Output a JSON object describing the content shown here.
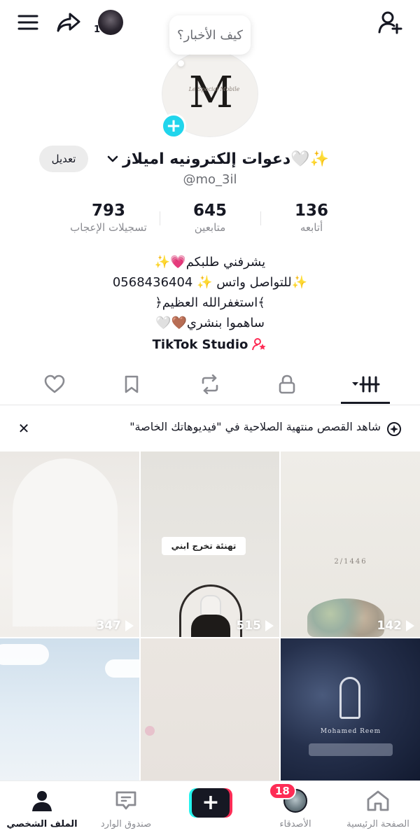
{
  "topbar": {
    "story_count": "1",
    "icons": [
      "menu-icon",
      "share-icon",
      "story-avatar",
      "add-friend-icon"
    ]
  },
  "bubble": {
    "text": "كيف الأخبار؟"
  },
  "profile": {
    "monogram": "M",
    "monogram_script": "Le Special Mobile",
    "display_name": "دعوات إلكترونيه اميلاز🤍✨",
    "username": "@mo_3il",
    "edit_label": "تعديل"
  },
  "stats": [
    {
      "value": "136",
      "label": "أتابعه"
    },
    {
      "value": "645",
      "label": "متابعين"
    },
    {
      "value": "793",
      "label": "تسجيلات الإعجاب"
    }
  ],
  "bio": {
    "lines": [
      "يشرفني طلبكم💗✨",
      "✨للتواصل واتس ✨ 0568436404",
      "﴾استغفرالله العظيم﴿",
      "ساهموا بنشري🤎🤍"
    ],
    "studio_link": "TikTok Studio"
  },
  "tabs": [
    "videos-grid-icon",
    "lock-icon",
    "repost-icon",
    "favorites-icon",
    "liked-icon"
  ],
  "banner": {
    "text": "شاهد القصص منتهية الصلاحية في \"فيديوهاتك الخاصة\""
  },
  "grid": {
    "tiles": [
      {
        "views": "347"
      },
      {
        "views": "515",
        "caption": "تهنئة تخرج ابني"
      },
      {
        "views": "142",
        "caption": "2/1446"
      },
      {},
      {},
      {
        "caption": "Mohamed Reem"
      }
    ]
  },
  "bottom_nav": {
    "home": "الصفحة الرئيسية",
    "friends": "الأصدقاء",
    "friends_badge": "18",
    "inbox": "صندوق الوارد",
    "profile": "الملف الشخصي"
  },
  "colors": {
    "accent_cyan": "#20d5ec",
    "brand_red": "#fe2c55",
    "text": "#161823",
    "muted": "#8a8b91"
  }
}
